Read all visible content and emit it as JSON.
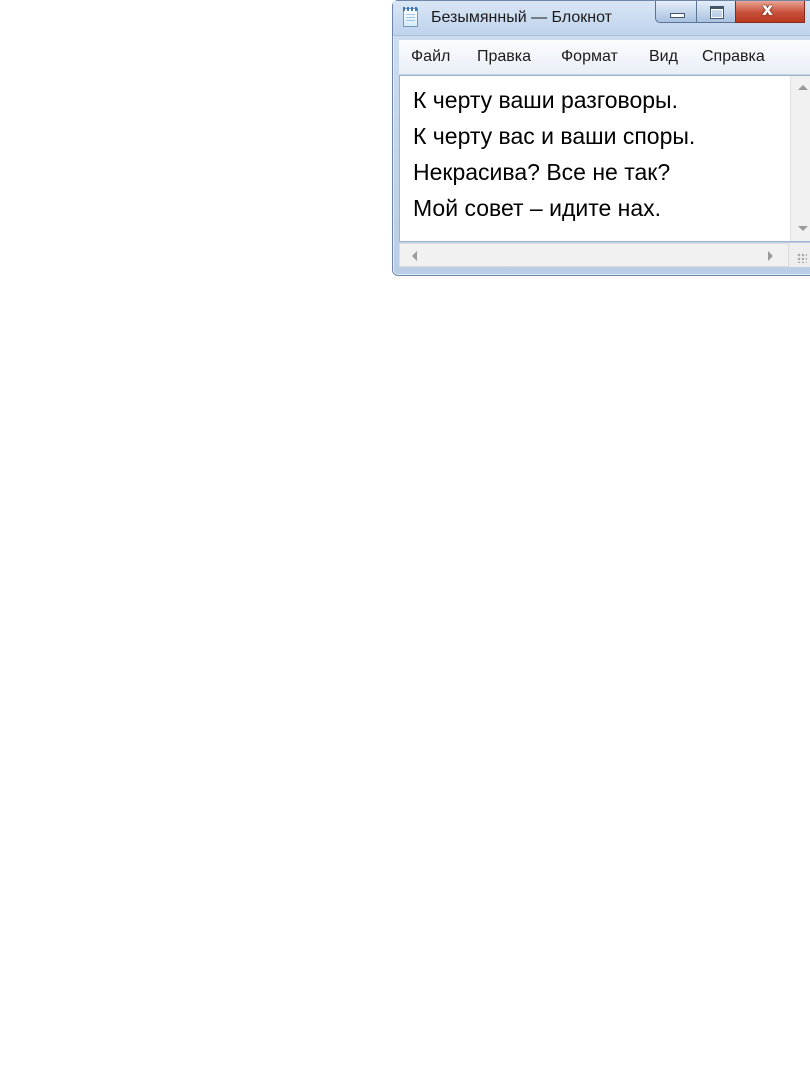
{
  "window": {
    "title": "Безымянный — Блокнот",
    "app_icon": "notepad-icon",
    "controls": {
      "minimize_icon": "minimize-icon",
      "maximize_icon": "maximize-icon",
      "close_icon": "close-icon",
      "close_glyph": "x"
    }
  },
  "menu": {
    "items": [
      {
        "label": "Файл"
      },
      {
        "label": "Правка"
      },
      {
        "label": "Формат"
      },
      {
        "label": "Вид"
      },
      {
        "label": "Справка"
      }
    ]
  },
  "editor": {
    "content": "К черту ваши разговоры.\nК черту вас и ваши споры.\nНекрасива? Все не так?\nМой совет – идите нах."
  },
  "colors": {
    "titlebar": "#c9dbf0",
    "close_button": "#c7503b",
    "editor_background": "#ffffff",
    "page_background": "#ffffff"
  }
}
